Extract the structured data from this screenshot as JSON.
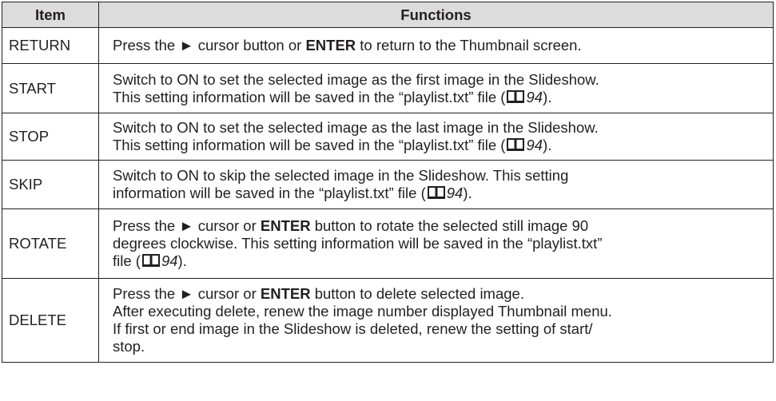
{
  "table": {
    "header": {
      "item": "Item",
      "functions": "Functions"
    },
    "rows": [
      {
        "item": "RETURN",
        "parts": {
          "a": "Press the ► cursor button or ",
          "b": "ENTER",
          "c": " to return to the Thumbnail screen."
        }
      },
      {
        "item": "START",
        "line1": "Switch to ON to set the selected image as the first image in the Slideshow.",
        "line2": "This setting information will be saved in the “playlist.txt” file (",
        "page": "94",
        "close": ")."
      },
      {
        "item": "STOP",
        "line1": "Switch to ON to set the selected image as the last image in the Slideshow.",
        "line2": "This setting information will be saved in the “playlist.txt” file (",
        "page": "94",
        "close": ")."
      },
      {
        "item": "SKIP",
        "line1": "Switch to ON to skip the selected image in the Slideshow. This setting",
        "line2": "information will be saved in the “playlist.txt” file (",
        "page": "94",
        "close": ")."
      },
      {
        "item": "ROTATE",
        "parts": {
          "a": "Press the ► cursor or ",
          "b": "ENTER",
          "c": " button to rotate the selected still image 90"
        },
        "line2": "degrees clockwise. This setting information will be saved in the “playlist.txt”",
        "line3": "file (",
        "page": "94",
        "close": ")."
      },
      {
        "item": "DELETE",
        "parts": {
          "a": "Press the ► cursor or ",
          "b": "ENTER",
          "c": " button to delete selected image."
        },
        "line2": "After executing delete, renew the image number displayed Thumbnail menu.",
        "line3": "If first or end image in the Slideshow is deleted, renew the setting of start/",
        "line4": "stop."
      }
    ]
  },
  "icons": {
    "reference": "book-icon",
    "color": "#231f20"
  }
}
